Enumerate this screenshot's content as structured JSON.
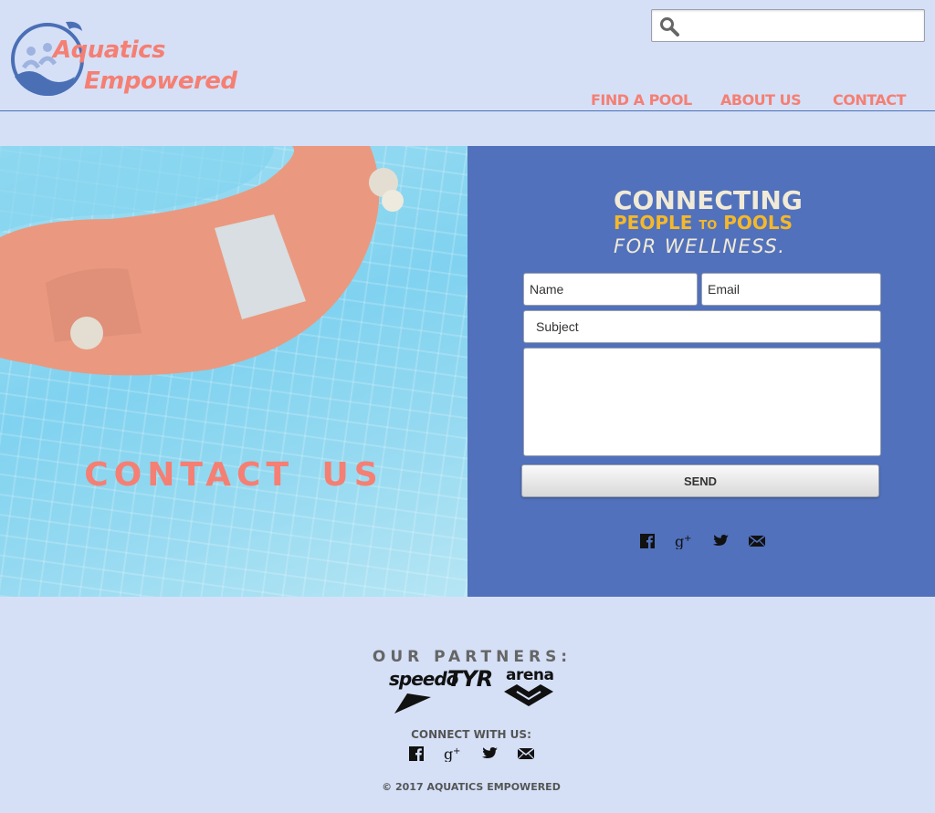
{
  "brand": {
    "line1": "Aquatics",
    "line2": "Empowered"
  },
  "search": {
    "placeholder": ""
  },
  "nav": [
    {
      "label": "FIND A POOL"
    },
    {
      "label": "ABOUT US"
    },
    {
      "label": "CONTACT"
    }
  ],
  "hero": {
    "title": "CONTACT US"
  },
  "tagline": {
    "line1": "CONNECTING",
    "people": "PEOPLE",
    "to": "TO",
    "pools": "POOLS",
    "line3": "FOR WELLNESS."
  },
  "form": {
    "name_placeholder": "Name",
    "email_placeholder": "Email",
    "subject_placeholder": "Subject",
    "message_placeholder": "",
    "send_label": "SEND"
  },
  "social_icons": [
    "facebook-icon",
    "google-plus-icon",
    "twitter-icon",
    "email-icon"
  ],
  "footer": {
    "partners_title": "OUR PARTNERS:",
    "partners": [
      "speedo",
      "TYR",
      "arena"
    ],
    "connect_title": "CONNECT WITH US:",
    "copyright": "© 2017 AQUATICS EMPOWERED"
  },
  "colors": {
    "accent": "#f57f73",
    "panel": "#5171bc",
    "background": "#d5e0f7",
    "gold": "#f5b82a"
  }
}
